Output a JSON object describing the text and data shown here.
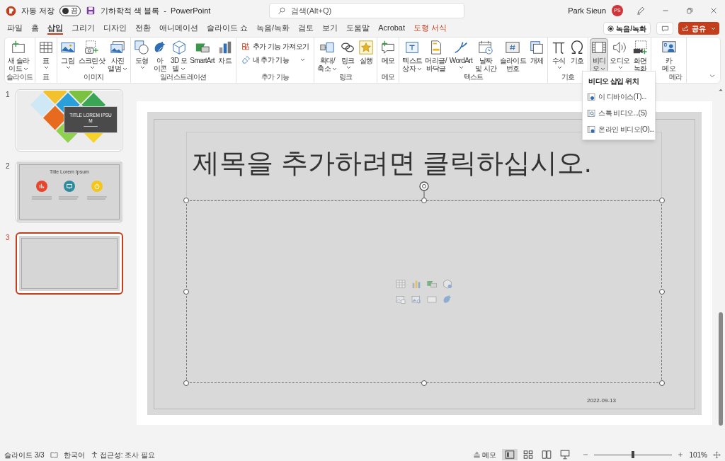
{
  "app": {
    "autosave_label": "자동 저장",
    "autosave": {
      "on": false,
      "label": "끔"
    },
    "title": "기하학적 색 블록  -  PowerPoint"
  },
  "search": {
    "placeholder": "검색(Alt+Q)"
  },
  "user": {
    "name": "Park Sieun",
    "initials": "PS"
  },
  "tabs": [
    {
      "label": "파일",
      "selected": false,
      "kind": "normal"
    },
    {
      "label": "홈",
      "selected": false,
      "kind": "normal"
    },
    {
      "label": "삽입",
      "selected": true,
      "kind": "normal"
    },
    {
      "label": "그리기",
      "selected": false,
      "kind": "normal"
    },
    {
      "label": "디자인",
      "selected": false,
      "kind": "normal"
    },
    {
      "label": "전환",
      "selected": false,
      "kind": "normal"
    },
    {
      "label": "애니메이션",
      "selected": false,
      "kind": "normal"
    },
    {
      "label": "슬라이드 쇼",
      "selected": false,
      "kind": "normal"
    },
    {
      "label": "녹음/녹화",
      "selected": false,
      "kind": "normal"
    },
    {
      "label": "검토",
      "selected": false,
      "kind": "normal"
    },
    {
      "label": "보기",
      "selected": false,
      "kind": "normal"
    },
    {
      "label": "도움말",
      "selected": false,
      "kind": "normal"
    },
    {
      "label": "Acrobat",
      "selected": false,
      "kind": "normal"
    },
    {
      "label": "도형 서식",
      "selected": false,
      "kind": "contextual"
    }
  ],
  "record_button": "녹음/녹화",
  "share_button": "공유",
  "ribbon": {
    "groups": [
      {
        "label": "슬라이드",
        "buttons": [
          {
            "label": "새 슬라\n이드",
            "kind": "large",
            "menu": true,
            "pressed": false
          }
        ]
      },
      {
        "label": "표",
        "buttons": [
          {
            "label": "표",
            "kind": "large",
            "menu": true,
            "pressed": false
          }
        ]
      },
      {
        "label": "이미지",
        "buttons": [
          {
            "label": "그림",
            "kind": "large",
            "menu": true,
            "pressed": false
          },
          {
            "label": "스크린샷",
            "kind": "large",
            "menu": true,
            "pressed": false
          },
          {
            "label": "사진\n앨범",
            "kind": "large",
            "menu": true,
            "pressed": false
          }
        ]
      },
      {
        "label": "일러스트레이션",
        "buttons": [
          {
            "label": "도형",
            "kind": "large",
            "menu": true,
            "pressed": false
          },
          {
            "label": "아\n이콘",
            "kind": "large",
            "menu": false,
            "pressed": false
          },
          {
            "label": "3D 모\n델",
            "kind": "large",
            "menu": true,
            "pressed": false
          },
          {
            "label": "SmartArt",
            "kind": "large",
            "menu": false,
            "pressed": false
          },
          {
            "label": "차트",
            "kind": "large",
            "menu": false,
            "pressed": false
          }
        ]
      },
      {
        "label": "추가 기능",
        "buttons": [
          {
            "label": "추가 기능 가져오기",
            "kind": "small",
            "menu": false,
            "pressed": false
          },
          {
            "label": "내 추가 기능",
            "kind": "small",
            "menu": true,
            "pressed": false
          }
        ]
      },
      {
        "label": "링크",
        "buttons": [
          {
            "label": "확대/\n축소",
            "kind": "large",
            "menu": true,
            "pressed": false
          },
          {
            "label": "링크",
            "kind": "large",
            "menu": true,
            "pressed": false
          },
          {
            "label": "실행",
            "kind": "large",
            "menu": false,
            "pressed": false
          }
        ]
      },
      {
        "label": "메모",
        "buttons": [
          {
            "label": "메모",
            "kind": "large",
            "menu": false,
            "pressed": false
          }
        ]
      },
      {
        "label": "텍스트",
        "buttons": [
          {
            "label": "텍스트\n상자",
            "kind": "large",
            "menu": true,
            "pressed": false
          },
          {
            "label": "머리글/\n바닥글",
            "kind": "large",
            "menu": false,
            "pressed": false
          },
          {
            "label": "WordArt",
            "kind": "large",
            "menu": true,
            "pressed": false
          },
          {
            "label": "날짜\n및 시간",
            "kind": "large",
            "menu": false,
            "pressed": false
          },
          {
            "label": "슬라이드\n번호",
            "kind": "large",
            "menu": false,
            "pressed": false
          },
          {
            "label": "개체",
            "kind": "large",
            "menu": false,
            "pressed": false
          }
        ]
      },
      {
        "label": "기호",
        "buttons": [
          {
            "label": "수식",
            "kind": "large",
            "menu": true,
            "pressed": false
          },
          {
            "label": "기호",
            "kind": "large",
            "menu": false,
            "pressed": false
          }
        ]
      },
      {
        "buttons": [
          {
            "label": "비디\n오",
            "kind": "large",
            "menu": true,
            "pressed": true
          },
          {
            "label": "오디오",
            "kind": "large",
            "menu": true,
            "pressed": false
          },
          {
            "label": "화면\n녹화",
            "kind": "large",
            "menu": false,
            "pressed": false
          }
        ]
      },
      {
        "label": "메라",
        "buttons": [
          {
            "label": "카\n메오",
            "kind": "large",
            "menu": false,
            "pressed": false
          }
        ]
      }
    ]
  },
  "video_menu": {
    "title": "비디오 삽입 위치",
    "items": [
      "이 디바이스(T)...",
      "스톡 비디오...(S)",
      "온라인 비디오(O)..."
    ]
  },
  "slides": [
    {
      "number": "1",
      "selected": false,
      "kind": "photo-title",
      "title": "TITLE LOREM IPSU\nM"
    },
    {
      "number": "2",
      "selected": false,
      "kind": "icons",
      "title": "Title Lorem Ipsum",
      "circles": [
        {
          "color": "#e8452c"
        },
        {
          "color": "#2e8b9e"
        },
        {
          "color": "#f5c518"
        }
      ]
    },
    {
      "number": "3",
      "selected": true,
      "kind": "blank"
    }
  ],
  "slide": {
    "title_placeholder": "제목을 추가하려면 클릭하십시오.",
    "date": "2022-09-13"
  },
  "status_bar": {
    "slide": "슬라이드 3/3",
    "language": "한국어",
    "accessibility": "접근성: 조사 필요",
    "notes": "메모",
    "views": [
      {
        "selected": true
      },
      {
        "selected": false
      },
      {
        "selected": false
      },
      {
        "selected": false
      }
    ],
    "zoom": {
      "level": 0.5,
      "reading": "101%"
    }
  }
}
